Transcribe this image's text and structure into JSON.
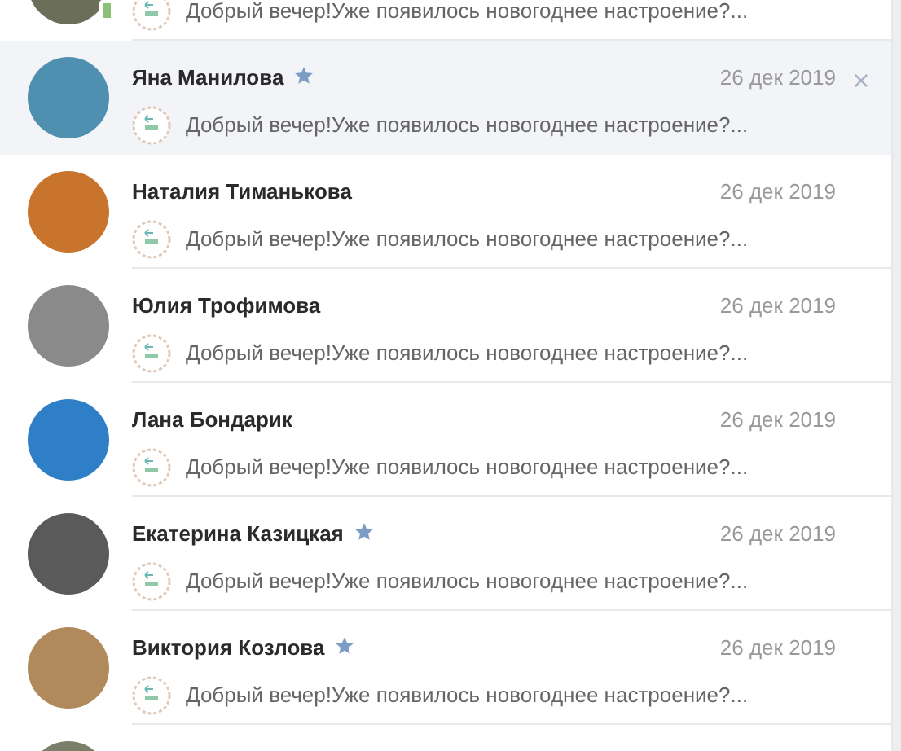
{
  "dialogs": [
    {
      "message": "Добрый вечер!Уже появилось новогоднее настроение?...",
      "online": true,
      "starred": false,
      "selected": false
    },
    {
      "name": "Яна Манилова",
      "starred": true,
      "date": "26 дек 2019",
      "message": "Добрый вечер!Уже появилось новогоднее настроение?...",
      "online": false,
      "selected": true
    },
    {
      "name": "Наталия Тиманькова",
      "starred": false,
      "date": "26 дек 2019",
      "message": "Добрый вечер!Уже появилось новогоднее настроение?...",
      "online": false,
      "selected": false
    },
    {
      "name": "Юлия Трофимова",
      "starred": false,
      "date": "26 дек 2019",
      "message": "Добрый вечер!Уже появилось новогоднее настроение?...",
      "online": false,
      "selected": false
    },
    {
      "name": "Лана Бондарик",
      "starred": false,
      "date": "26 дек 2019",
      "message": "Добрый вечер!Уже появилось новогоднее настроение?...",
      "online": false,
      "selected": false
    },
    {
      "name": "Екатерина Казицкая",
      "starred": true,
      "date": "26 дек 2019",
      "message": "Добрый вечер!Уже появилось новогоднее настроение?...",
      "online": false,
      "selected": false
    },
    {
      "name": "Виктория Козлова",
      "starred": true,
      "date": "26 дек 2019",
      "message": "Добрый вечер!Уже появилось новогоднее настроение?...",
      "online": false,
      "selected": false
    },
    {
      "online": false,
      "starred": false,
      "selected": false
    }
  ]
}
